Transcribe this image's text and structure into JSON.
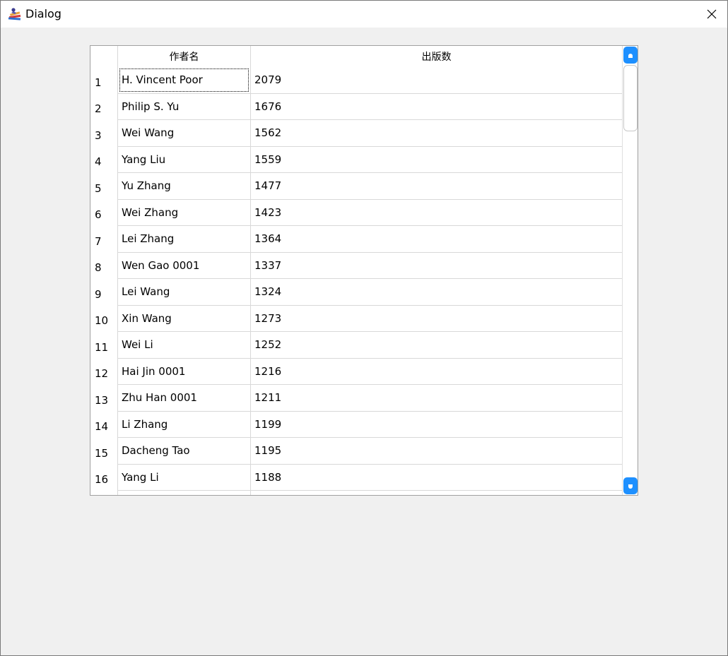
{
  "window": {
    "title": "Dialog",
    "icon": "books-app-icon",
    "close_icon": "close-icon"
  },
  "table": {
    "columns": [
      "作者名",
      "出版数"
    ],
    "rows": [
      {
        "num": "1",
        "name": "H. Vincent Poor",
        "count": "2079"
      },
      {
        "num": "2",
        "name": "Philip S. Yu",
        "count": "1676"
      },
      {
        "num": "3",
        "name": "Wei Wang",
        "count": "1562"
      },
      {
        "num": "4",
        "name": "Yang Liu",
        "count": "1559"
      },
      {
        "num": "5",
        "name": "Yu Zhang",
        "count": "1477"
      },
      {
        "num": "6",
        "name": "Wei Zhang",
        "count": "1423"
      },
      {
        "num": "7",
        "name": "Lei Zhang",
        "count": "1364"
      },
      {
        "num": "8",
        "name": "Wen Gao 0001",
        "count": "1337"
      },
      {
        "num": "9",
        "name": "Lei Wang",
        "count": "1324"
      },
      {
        "num": "10",
        "name": "Xin Wang",
        "count": "1273"
      },
      {
        "num": "11",
        "name": "Wei Li",
        "count": "1252"
      },
      {
        "num": "12",
        "name": "Hai Jin 0001",
        "count": "1216"
      },
      {
        "num": "13",
        "name": "Zhu Han 0001",
        "count": "1211"
      },
      {
        "num": "14",
        "name": "Li Zhang",
        "count": "1199"
      },
      {
        "num": "15",
        "name": "Dacheng Tao",
        "count": "1195"
      },
      {
        "num": "16",
        "name": "Yang Li",
        "count": "1188"
      }
    ]
  },
  "colors": {
    "scrollbar_accent": "#1e90ff",
    "grid_line": "#d8d8d8",
    "background": "#f0f0f0"
  }
}
